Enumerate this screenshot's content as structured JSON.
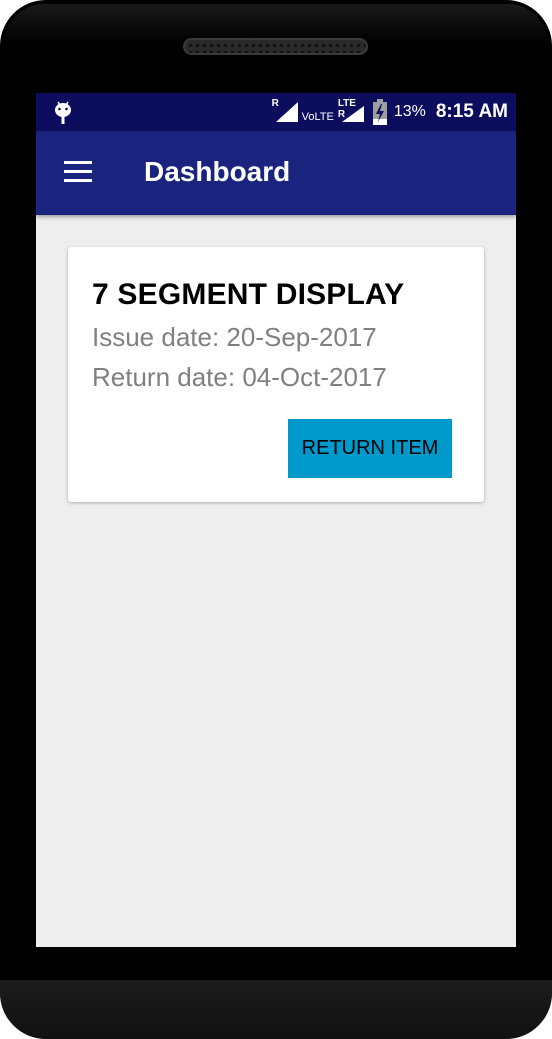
{
  "status_bar": {
    "sim1_tag": "R",
    "volte": "VoLTE",
    "sim2_tag": "LTE R",
    "battery_percent": "13%",
    "time": "8:15 AM",
    "icons": [
      "android-icon",
      "signal-icon",
      "battery-charging-icon"
    ]
  },
  "app_bar": {
    "title": "Dashboard",
    "menu_icon": "hamburger-menu-icon"
  },
  "card": {
    "title": "7 SEGMENT DISPLAY",
    "issue_line": "Issue date: 20-Sep-2017",
    "return_line": "Return date: 04-Oct-2017",
    "button_label": "RETURN ITEM"
  },
  "colors": {
    "status_bar": "#0d0d5e",
    "app_bar": "#1a237e",
    "button": "#0099cc",
    "background": "#eeeeee"
  }
}
